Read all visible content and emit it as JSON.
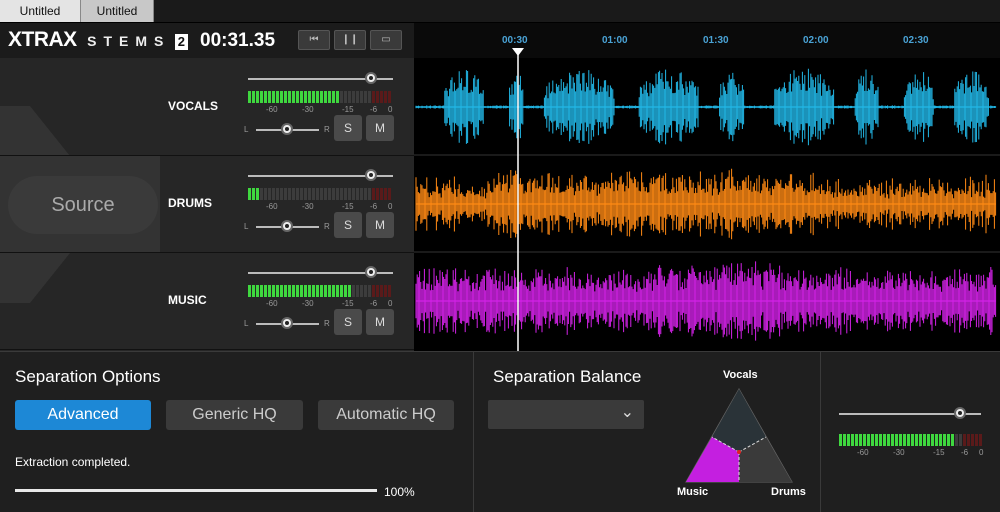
{
  "tabs": [
    {
      "label": "Untitled",
      "active": true
    },
    {
      "label": "Untitled",
      "active": false
    }
  ],
  "header": {
    "logo_main": "XTRAX",
    "logo_stems": "STEMS",
    "logo_version": "2",
    "timecode": "00:31.35",
    "transport": [
      {
        "icon": "skip-start-icon",
        "glyph": "⏮"
      },
      {
        "icon": "pause-icon",
        "glyph": "❙❙"
      },
      {
        "icon": "loop-icon",
        "glyph": "▭"
      }
    ]
  },
  "ruler": {
    "ticks": [
      "00:30",
      "01:00",
      "01:30",
      "02:00",
      "02:30"
    ]
  },
  "source_label": "Source",
  "meter_scale": [
    "-60",
    "-30",
    "-15",
    "-6",
    "0"
  ],
  "pan_labels": {
    "left": "L",
    "right": "R"
  },
  "tracks": [
    {
      "name": "VOCALS",
      "solo": "S",
      "mute": "M",
      "color": "#22b8e8",
      "level": 0.85,
      "meter": 0.62
    },
    {
      "name": "DRUMS",
      "solo": "S",
      "mute": "M",
      "color": "#ff8a14",
      "level": 0.85,
      "meter": 0.06
    },
    {
      "name": "MUSIC",
      "solo": "S",
      "mute": "M",
      "color": "#d322e8",
      "level": 0.85,
      "meter": 0.72
    }
  ],
  "separation_options": {
    "title": "Separation Options",
    "buttons": [
      {
        "label": "Advanced",
        "active": true
      },
      {
        "label": "Generic HQ",
        "active": false
      },
      {
        "label": "Automatic HQ",
        "active": false
      }
    ],
    "status": "Extraction completed.",
    "progress_label": "100%",
    "progress": 1.0
  },
  "separation_balance": {
    "title": "Separation Balance",
    "dropdown_value": "",
    "vocals": "Vocals",
    "music": "Music",
    "drums": "Drums"
  },
  "master": {
    "level": 0.85,
    "meter": 0.78
  },
  "colors": {
    "accent": "#1d88d6",
    "vocals": "#22b8e8",
    "drums": "#ff8a14",
    "music": "#d322e8",
    "meter_green": "#3fd83f",
    "meter_red": "#e02020"
  }
}
